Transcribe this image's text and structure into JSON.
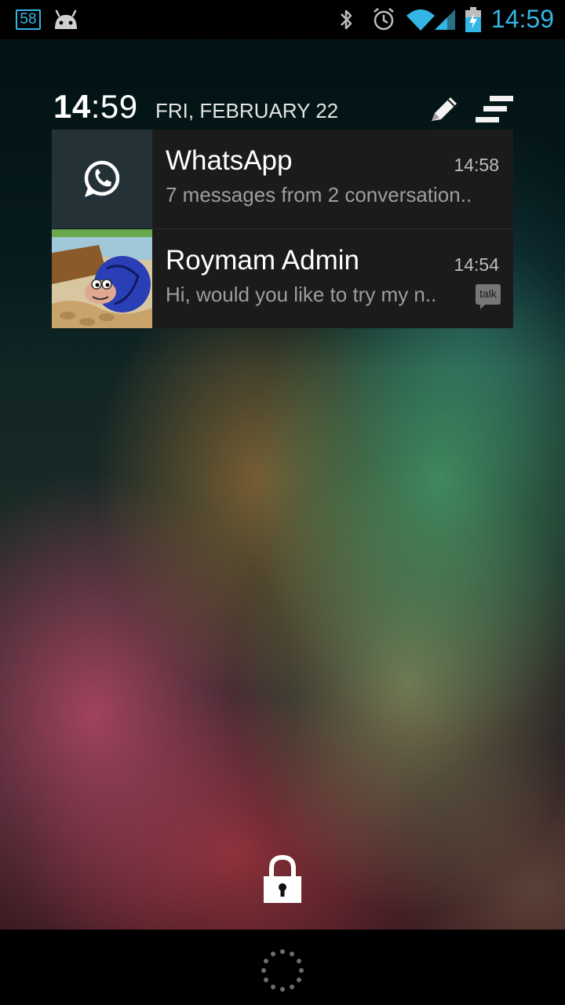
{
  "status_bar": {
    "notification_count": "58",
    "icons": [
      "android-icon",
      "bluetooth-icon",
      "alarm-icon",
      "wifi-icon",
      "signal-icon",
      "battery-charging-icon"
    ],
    "clock": "14:59",
    "accent_color": "#33b5e5"
  },
  "header": {
    "time_hours": "14",
    "time_minutes": ":59",
    "date": "FRI, FEBRUARY 22",
    "icons": [
      "edit-pencil-icon",
      "clear-all-icon"
    ]
  },
  "notifications": [
    {
      "app_icon": "whatsapp-icon",
      "title": "WhatsApp",
      "time": "14:58",
      "text": "7 messages from 2 conversation.."
    },
    {
      "app_icon": "game-avatar-icon",
      "title": "Roymam Admin",
      "time": "14:54",
      "text": "Hi, would you like to try my n..",
      "badge": "talk"
    }
  ],
  "lock": {
    "icon": "lock-icon"
  },
  "navbar": {
    "icon": "loading-spinner-icon"
  }
}
